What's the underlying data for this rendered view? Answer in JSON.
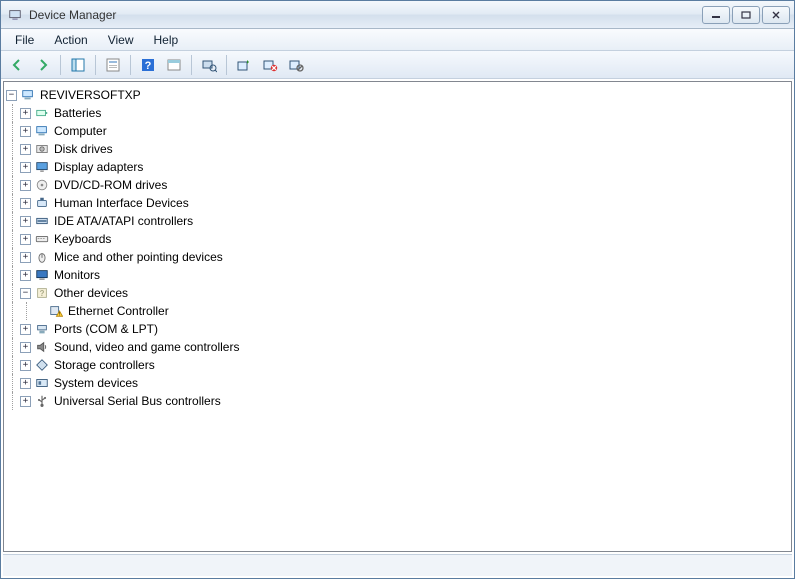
{
  "window": {
    "title": "Device Manager"
  },
  "menu": {
    "file": "File",
    "action": "Action",
    "view": "View",
    "help": "Help"
  },
  "tree": {
    "root": {
      "label": "REVIVERSOFTXP",
      "expanded": true,
      "icon": "computer-icon"
    },
    "categories": [
      {
        "label": "Batteries",
        "icon": "battery-icon",
        "expanded": false
      },
      {
        "label": "Computer",
        "icon": "computer-icon",
        "expanded": false
      },
      {
        "label": "Disk drives",
        "icon": "disk-icon",
        "expanded": false
      },
      {
        "label": "Display adapters",
        "icon": "display-icon",
        "expanded": false
      },
      {
        "label": "DVD/CD-ROM drives",
        "icon": "cdrom-icon",
        "expanded": false
      },
      {
        "label": "Human Interface Devices",
        "icon": "hid-icon",
        "expanded": false
      },
      {
        "label": "IDE ATA/ATAPI controllers",
        "icon": "ide-icon",
        "expanded": false
      },
      {
        "label": "Keyboards",
        "icon": "keyboard-icon",
        "expanded": false
      },
      {
        "label": "Mice and other pointing devices",
        "icon": "mouse-icon",
        "expanded": false
      },
      {
        "label": "Monitors",
        "icon": "monitor-icon",
        "expanded": false
      },
      {
        "label": "Other devices",
        "icon": "other-icon",
        "expanded": true,
        "children": [
          {
            "label": "Ethernet Controller",
            "icon": "warning-device-icon"
          }
        ]
      },
      {
        "label": "Ports (COM & LPT)",
        "icon": "port-icon",
        "expanded": false
      },
      {
        "label": "Sound, video and game controllers",
        "icon": "sound-icon",
        "expanded": false
      },
      {
        "label": "Storage controllers",
        "icon": "storage-icon",
        "expanded": false
      },
      {
        "label": "System devices",
        "icon": "system-icon",
        "expanded": false
      },
      {
        "label": "Universal Serial Bus controllers",
        "icon": "usb-icon",
        "expanded": false
      }
    ]
  }
}
